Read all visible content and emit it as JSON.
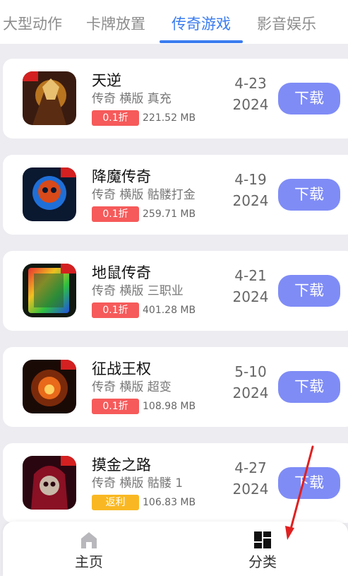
{
  "tabs": [
    {
      "label": "大型动作"
    },
    {
      "label": "卡牌放置"
    },
    {
      "label": "传奇游戏",
      "active": true
    },
    {
      "label": "影音娱乐"
    }
  ],
  "apps": [
    {
      "name": "天逆",
      "tags": "传奇 横版 真充",
      "badge": "0.1折",
      "badge_color": "red",
      "size": "221.52 MB",
      "date_md": "4-23",
      "date_year": "2024",
      "download_label": "下载"
    },
    {
      "name": "降魔传奇",
      "tags": "传奇 横版 骷髅打金",
      "badge": "0.1折",
      "badge_color": "red",
      "size": "259.71 MB",
      "date_md": "4-19",
      "date_year": "2024",
      "download_label": "下载"
    },
    {
      "name": "地鼠传奇",
      "tags": "传奇 横版 三职业",
      "badge": "0.1折",
      "badge_color": "red",
      "size": "401.28 MB",
      "date_md": "4-21",
      "date_year": "2024",
      "download_label": "下载"
    },
    {
      "name": "征战王权",
      "tags": "传奇 横版 超变",
      "badge": "0.1折",
      "badge_color": "red",
      "size": "108.98 MB",
      "date_md": "5-10",
      "date_year": "2024",
      "download_label": "下载"
    },
    {
      "name": "摸金之路",
      "tags": "传奇 横版 骷髅 1",
      "badge": "返利",
      "badge_color": "yellow",
      "size": "106.83 MB",
      "date_md": "4-27",
      "date_year": "2024",
      "download_label": "下载"
    }
  ],
  "bottom_nav": [
    {
      "label": "主页",
      "icon": "home-icon"
    },
    {
      "label": "分类",
      "icon": "category-icon"
    }
  ],
  "colors": {
    "accent": "#3a7cf0",
    "download_button": "#7f8cf6",
    "badge_red": "#f65a5a",
    "badge_yellow": "#f9b823",
    "annotation_arrow": "#e02020"
  }
}
